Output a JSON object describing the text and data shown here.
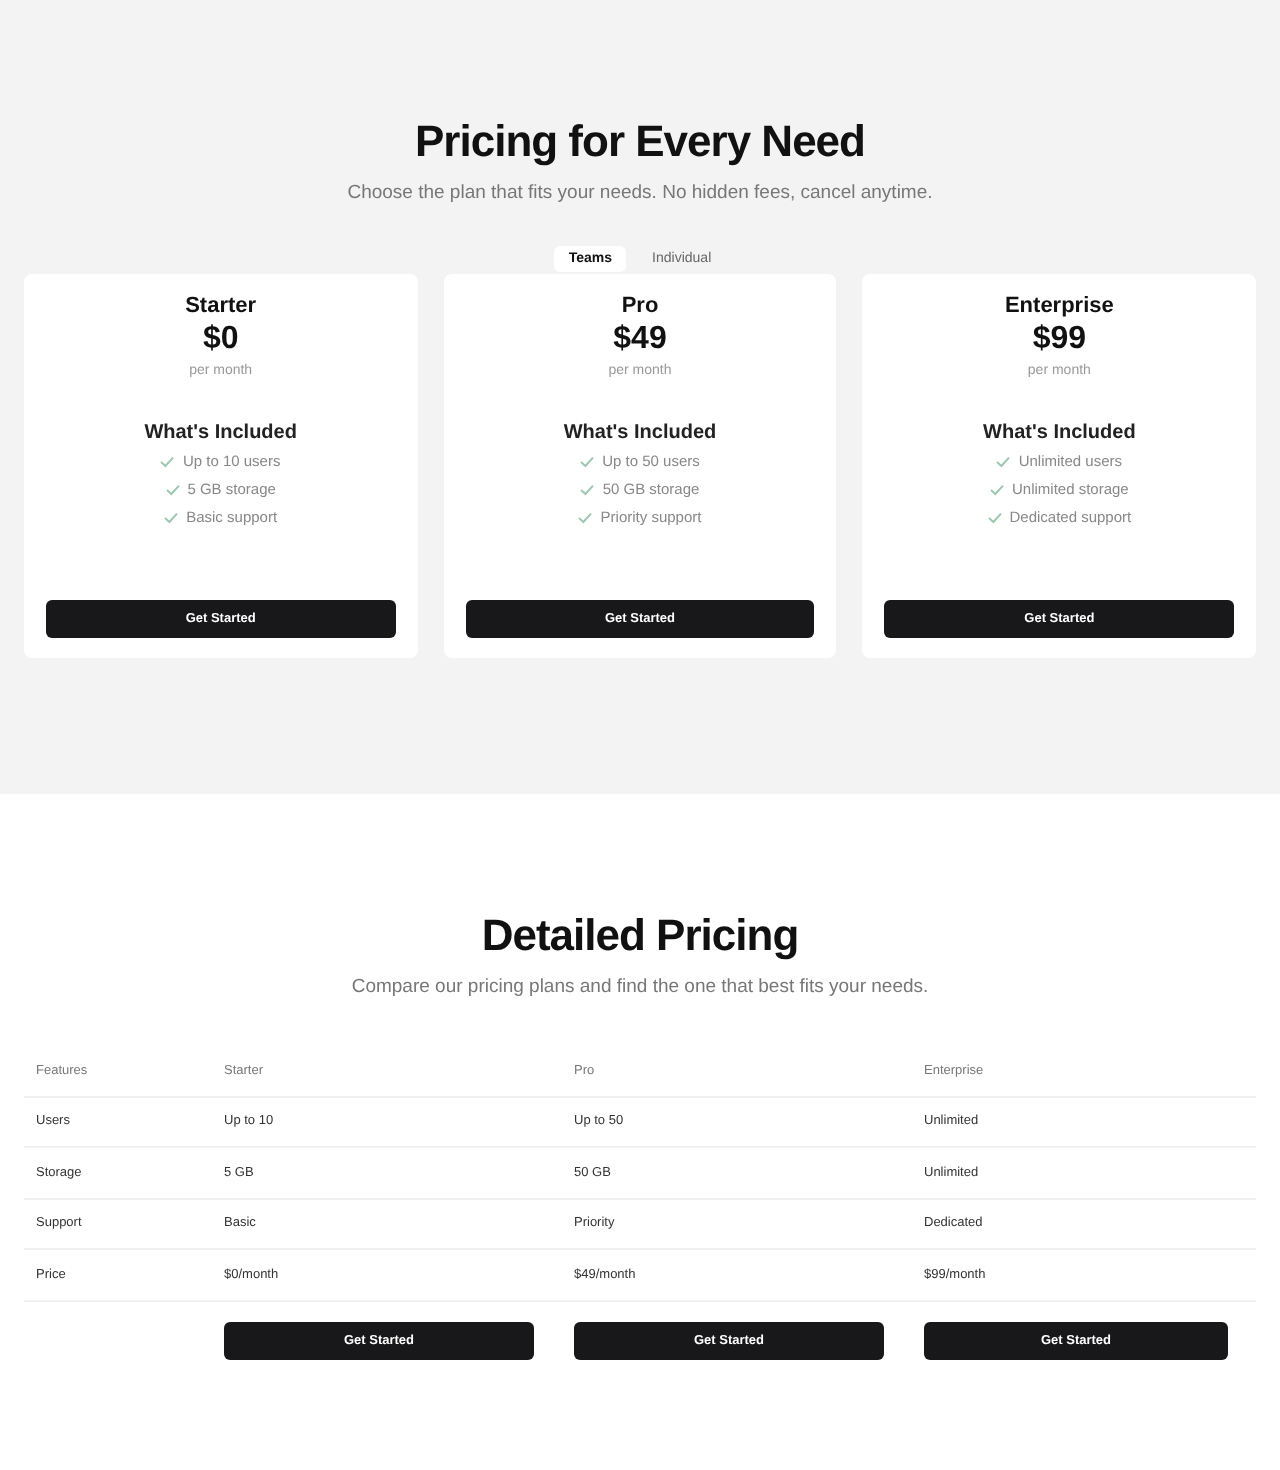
{
  "hero": {
    "title": "Pricing for Every Need",
    "subtitle": "Choose the plan that fits your needs. No hidden fees, cancel anytime."
  },
  "tabs": [
    {
      "label": "Teams",
      "selected": true
    },
    {
      "label": "Individual",
      "selected": false
    }
  ],
  "plans": [
    {
      "name": "Starter",
      "price": "$0",
      "period": "per month",
      "included_title": "What's Included",
      "features": [
        "Up to 10 users",
        "5 GB storage",
        "Basic support"
      ],
      "button": "Get Started"
    },
    {
      "name": "Pro",
      "price": "$49",
      "period": "per month",
      "included_title": "What's Included",
      "features": [
        "Up to 50 users",
        "50 GB storage",
        "Priority support"
      ],
      "button": "Get Started"
    },
    {
      "name": "Enterprise",
      "price": "$99",
      "period": "per month",
      "included_title": "What's Included",
      "features": [
        "Unlimited users",
        "Unlimited storage",
        "Dedicated support"
      ],
      "button": "Get Started"
    }
  ],
  "details": {
    "title": "Detailed Pricing",
    "subtitle": "Compare our pricing plans and find the one that best fits your needs.",
    "table": {
      "columns": [
        "Features",
        "Starter",
        "Pro",
        "Enterprise"
      ],
      "rows": [
        [
          "Users",
          "Up to 10",
          "Up to 50",
          "Unlimited"
        ],
        [
          "Storage",
          "5 GB",
          "50 GB",
          "Unlimited"
        ],
        [
          "Support",
          "Basic",
          "Priority",
          "Dedicated"
        ],
        [
          "Price",
          "$0/month",
          "$49/month",
          "$99/month"
        ]
      ],
      "buttons": [
        "Get Started",
        "Get Started",
        "Get Started"
      ]
    }
  }
}
